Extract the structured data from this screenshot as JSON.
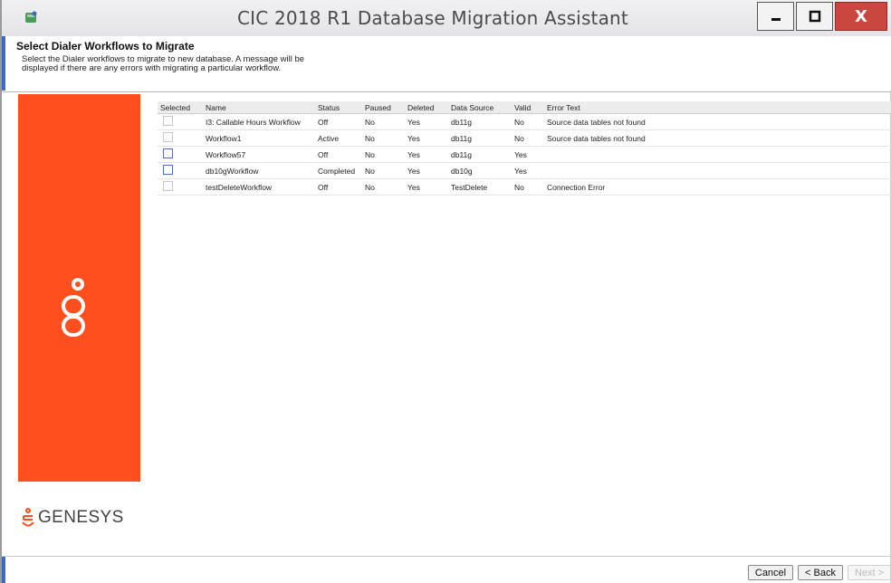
{
  "window": {
    "title": "CIC 2018 R1 Database Migration Assistant",
    "controls": {
      "minimize": "—",
      "maximize": "□",
      "close": "X"
    }
  },
  "header": {
    "title": "Select Dialer Workflows to Migrate",
    "description": "Select the Dialer workflows to migrate to new database. A message will be displayed if there are any errors with migrating a particular workflow."
  },
  "brand": {
    "name": "GENESYS",
    "logo_mark": "oo°",
    "accent": "#ff4f1f"
  },
  "table": {
    "columns": [
      "Selected",
      "Name",
      "Status",
      "Paused",
      "Deleted",
      "Data Source",
      "Valid",
      "Error Text"
    ],
    "rows": [
      {
        "selected": false,
        "enabled": false,
        "name": "I3: Callable Hours Workflow",
        "status": "Off",
        "paused": "No",
        "deleted": "Yes",
        "data_source": "db11g",
        "valid": "No",
        "error_text": "Source data tables not found"
      },
      {
        "selected": false,
        "enabled": false,
        "name": "Workflow1",
        "status": "Active",
        "paused": "No",
        "deleted": "Yes",
        "data_source": "db11g",
        "valid": "No",
        "error_text": "Source data tables not found"
      },
      {
        "selected": false,
        "enabled": true,
        "name": "Workflow57",
        "status": "Off",
        "paused": "No",
        "deleted": "Yes",
        "data_source": "db11g",
        "valid": "Yes",
        "error_text": ""
      },
      {
        "selected": false,
        "enabled": true,
        "name": "db10gWorkflow",
        "status": "Completed",
        "paused": "No",
        "deleted": "Yes",
        "data_source": "db10g",
        "valid": "Yes",
        "error_text": ""
      },
      {
        "selected": false,
        "enabled": false,
        "name": "testDeleteWorkflow",
        "status": "Off",
        "paused": "No",
        "deleted": "Yes",
        "data_source": "TestDelete",
        "valid": "No",
        "error_text": "Connection Error"
      }
    ]
  },
  "footer": {
    "cancel_label": "Cancel",
    "back_label": "< Back",
    "next_label": "Next >"
  }
}
